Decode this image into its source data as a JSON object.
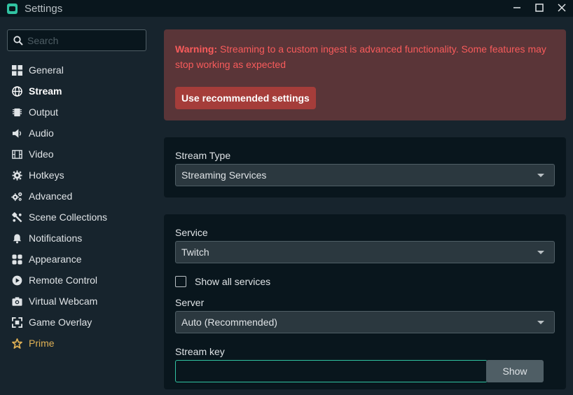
{
  "window": {
    "title": "Settings"
  },
  "search": {
    "placeholder": "Search"
  },
  "sidebar": {
    "items": [
      {
        "label": "General",
        "icon": "grid-icon"
      },
      {
        "label": "Stream",
        "icon": "globe-icon"
      },
      {
        "label": "Output",
        "icon": "chip-icon"
      },
      {
        "label": "Audio",
        "icon": "speaker-icon"
      },
      {
        "label": "Video",
        "icon": "film-icon"
      },
      {
        "label": "Hotkeys",
        "icon": "gear-icon"
      },
      {
        "label": "Advanced",
        "icon": "gears-icon"
      },
      {
        "label": "Scene Collections",
        "icon": "paint-icon"
      },
      {
        "label": "Notifications",
        "icon": "bell-icon"
      },
      {
        "label": "Appearance",
        "icon": "layout-icon"
      },
      {
        "label": "Remote Control",
        "icon": "play-circle-icon"
      },
      {
        "label": "Virtual Webcam",
        "icon": "camera-icon"
      },
      {
        "label": "Game Overlay",
        "icon": "expand-icon"
      },
      {
        "label": "Prime",
        "icon": "star-icon"
      }
    ],
    "active": "Stream"
  },
  "warning": {
    "prefix": "Warning:",
    "message": "Streaming to a custom ingest is advanced functionality. Some features may stop working as expected",
    "button_label": "Use recommended settings"
  },
  "stream_type": {
    "label": "Stream Type",
    "value": "Streaming Services"
  },
  "service": {
    "label": "Service",
    "value": "Twitch",
    "show_all_label": "Show all services",
    "show_all_checked": false
  },
  "server": {
    "label": "Server",
    "value": "Auto (Recommended)"
  },
  "stream_key": {
    "label": "Stream key",
    "value": "",
    "show_label": "Show"
  },
  "colors": {
    "background": "#17242d",
    "card": "#09161d",
    "accent": "#31c3a2",
    "warning_bg": "#5a3538",
    "warning_text": "#f85b5b",
    "warning_button": "#a53d3a",
    "prime": "#e0b155"
  }
}
